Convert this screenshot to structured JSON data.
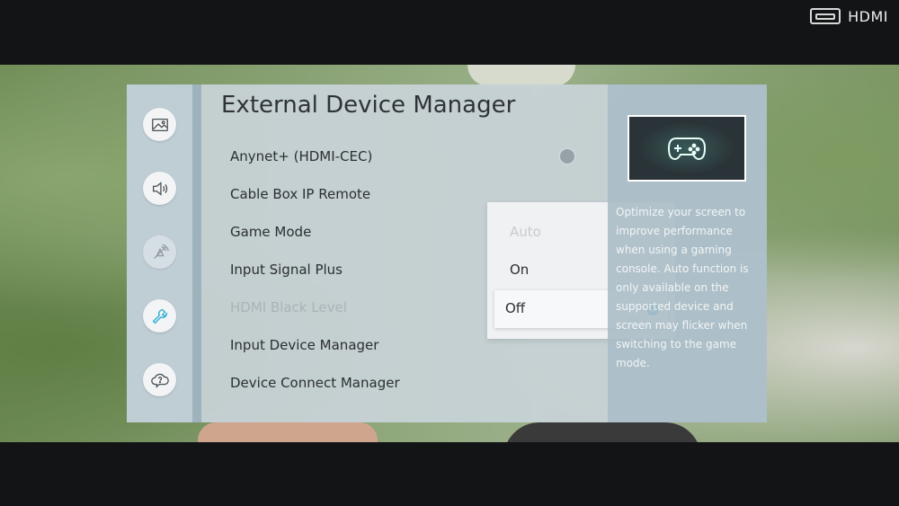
{
  "source": {
    "badge_label": "HDMI",
    "icon": "hdmi-port-icon"
  },
  "sidebar": {
    "items": [
      {
        "icon": "picture-icon",
        "label": ""
      },
      {
        "icon": "sound-icon",
        "label": ""
      },
      {
        "icon": "broadcast-icon",
        "label": ""
      },
      {
        "icon": "wrench-icon",
        "label": ""
      },
      {
        "icon": "support-cloud-icon",
        "label": ""
      }
    ]
  },
  "main": {
    "title": "External Device Manager",
    "items": [
      {
        "label": "Anynet+ (HDMI-CEC)",
        "state": "off"
      },
      {
        "label": "Cable Box IP Remote"
      },
      {
        "label": "Game Mode"
      },
      {
        "label": "Input Signal Plus"
      },
      {
        "label": "HDMI Black Level",
        "disabled": true
      },
      {
        "label": "Input Device Manager"
      },
      {
        "label": "Device Connect Manager"
      }
    ]
  },
  "dropdown": {
    "options": [
      {
        "label": "Auto",
        "disabled": true
      },
      {
        "label": "On"
      },
      {
        "label": "Off",
        "selected": true
      }
    ],
    "check_icon": "check-circle-icon",
    "accent_color": "#3ab2d4"
  },
  "info": {
    "image_icon": "gamepad-icon",
    "description": "Optimize your screen to improve performance when using a gaming console. Auto function is only available on the supported device and screen may flicker when switching to the game mode."
  }
}
